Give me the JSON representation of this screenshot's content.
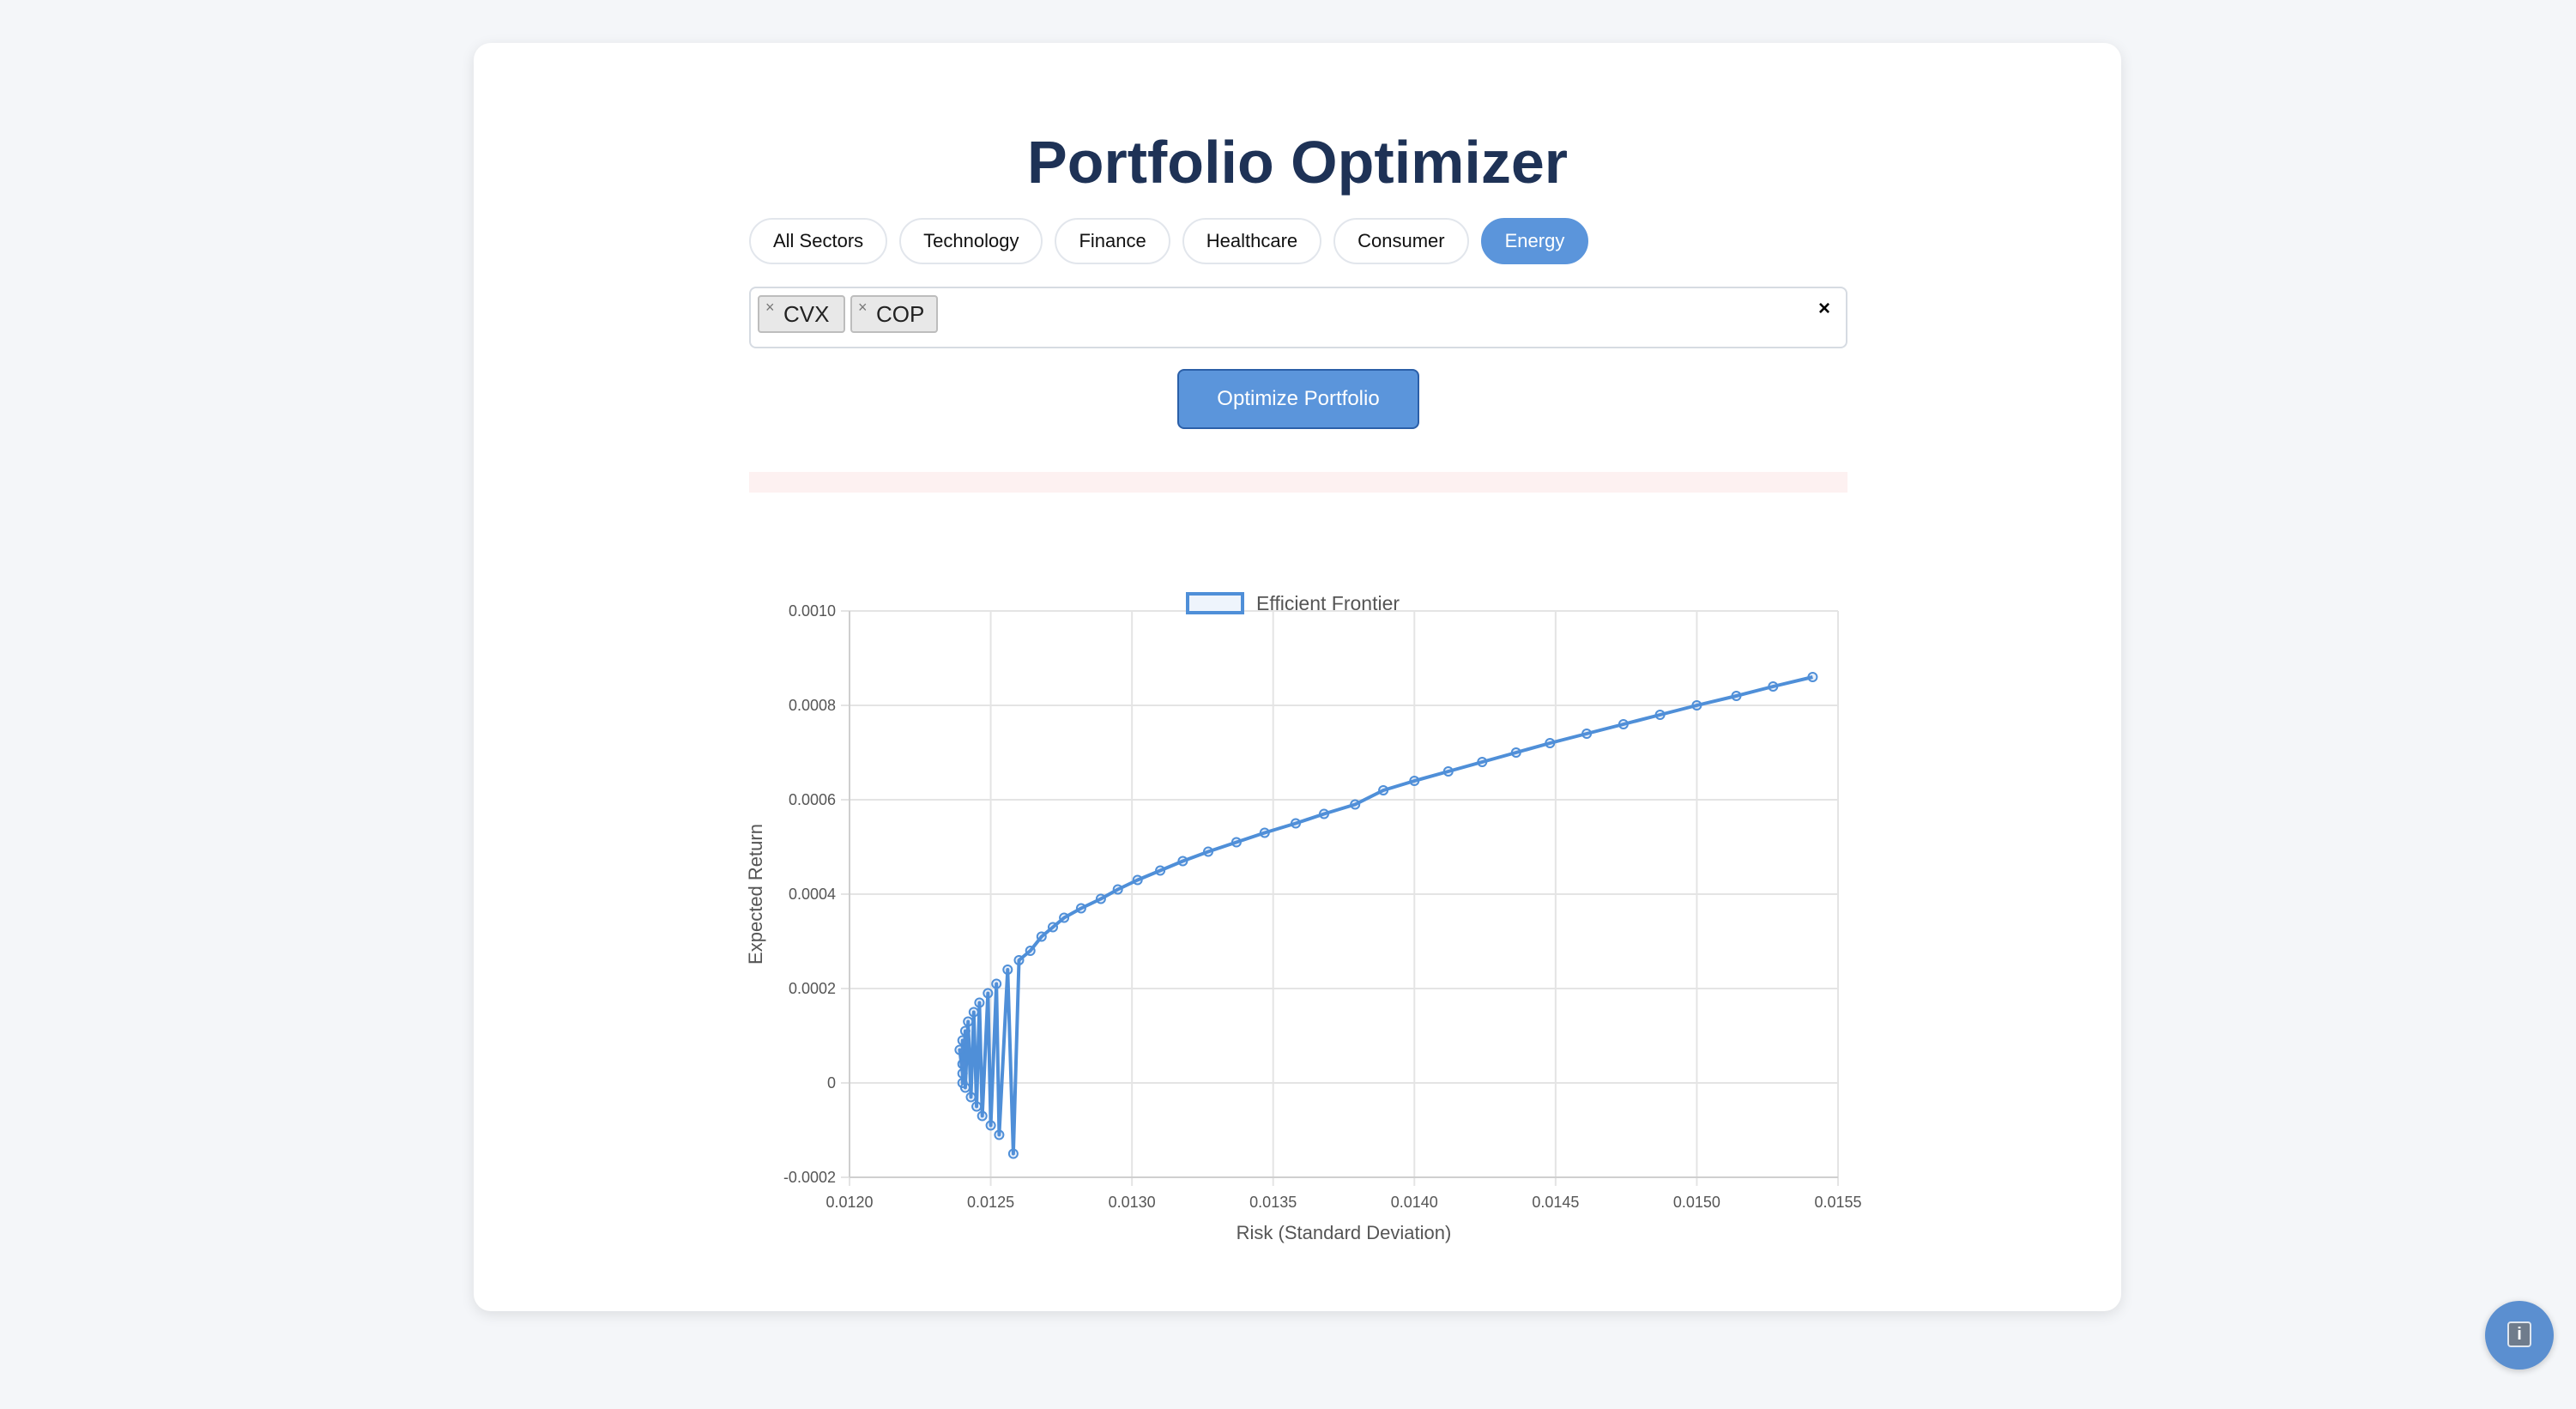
{
  "app": {
    "title": "Portfolio Optimizer"
  },
  "sectors": [
    {
      "label": "All Sectors",
      "active": false
    },
    {
      "label": "Technology",
      "active": false
    },
    {
      "label": "Finance",
      "active": false
    },
    {
      "label": "Healthcare",
      "active": false
    },
    {
      "label": "Consumer",
      "active": false
    },
    {
      "label": "Energy",
      "active": true
    }
  ],
  "selected_tickers": [
    "CVX",
    "COP"
  ],
  "tag_remove_glyph": "×",
  "clear_glyph": "×",
  "optimize_label": "Optimize Portfolio",
  "info_glyph": "i",
  "colors": {
    "accent": "#5b95db",
    "line": "#4f8fd8",
    "title": "#1e3256",
    "message_bg": "#fdf1f1"
  },
  "chart_data": {
    "type": "line",
    "legend": {
      "label": "Efficient Frontier",
      "placement": "top-center"
    },
    "xlabel": "Risk (Standard Deviation)",
    "ylabel": "Expected Return",
    "xlim": [
      0.012,
      0.0155
    ],
    "ylim": [
      -0.0002,
      0.001
    ],
    "xticks": [
      "0.0120",
      "0.0125",
      "0.0130",
      "0.0135",
      "0.0140",
      "0.0145",
      "0.0150",
      "0.0155"
    ],
    "yticks": [
      "-0.0002",
      "0",
      "0.0002",
      "0.0004",
      "0.0006",
      "0.0008",
      "0.0010"
    ],
    "grid": true,
    "series": [
      {
        "name": "Efficient Frontier",
        "points": [
          [
            0.0124,
            4e-05
          ],
          [
            0.01239,
            7e-05
          ],
          [
            0.0124,
            2e-05
          ],
          [
            0.0124,
            9e-05
          ],
          [
            0.0124,
            0.0
          ],
          [
            0.01241,
            0.00011
          ],
          [
            0.01241,
            -1e-05
          ],
          [
            0.01242,
            0.00013
          ],
          [
            0.01243,
            -3e-05
          ],
          [
            0.01244,
            0.00015
          ],
          [
            0.01245,
            -5e-05
          ],
          [
            0.01246,
            0.00017
          ],
          [
            0.01247,
            -7e-05
          ],
          [
            0.01249,
            0.00019
          ],
          [
            0.0125,
            -9e-05
          ],
          [
            0.01252,
            0.00021
          ],
          [
            0.01253,
            -0.00011
          ],
          [
            0.01256,
            0.00024
          ],
          [
            0.01258,
            -0.00015
          ],
          [
            0.0126,
            0.00026
          ],
          [
            0.01264,
            0.00028
          ],
          [
            0.01268,
            0.00031
          ],
          [
            0.01272,
            0.00033
          ],
          [
            0.01276,
            0.00035
          ],
          [
            0.01282,
            0.00037
          ],
          [
            0.01289,
            0.00039
          ],
          [
            0.01295,
            0.00041
          ],
          [
            0.01302,
            0.00043
          ],
          [
            0.0131,
            0.00045
          ],
          [
            0.01318,
            0.00047
          ],
          [
            0.01327,
            0.00049
          ],
          [
            0.01337,
            0.00051
          ],
          [
            0.01347,
            0.00053
          ],
          [
            0.01358,
            0.00055
          ],
          [
            0.01368,
            0.00057
          ],
          [
            0.01379,
            0.00059
          ],
          [
            0.01389,
            0.00062
          ],
          [
            0.014,
            0.00064
          ],
          [
            0.01412,
            0.00066
          ],
          [
            0.01424,
            0.00068
          ],
          [
            0.01436,
            0.0007
          ],
          [
            0.01448,
            0.00072
          ],
          [
            0.01461,
            0.00074
          ],
          [
            0.01474,
            0.00076
          ],
          [
            0.01487,
            0.00078
          ],
          [
            0.015,
            0.0008
          ],
          [
            0.01514,
            0.00082
          ],
          [
            0.01527,
            0.00084
          ],
          [
            0.01541,
            0.00086
          ]
        ]
      }
    ]
  }
}
